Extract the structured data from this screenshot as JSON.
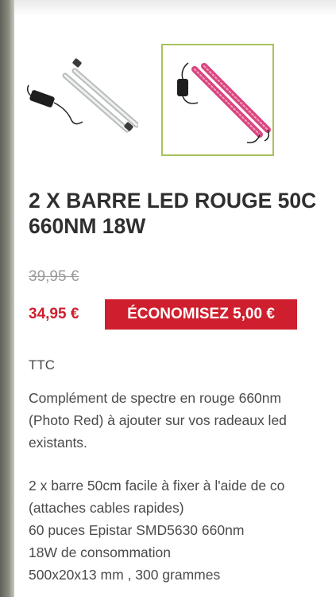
{
  "product": {
    "title_line1": "2 X BARRE LED ROUGE 50C",
    "title_line2": "660NM 18W",
    "old_price": "39,95 €",
    "price": "34,95 €",
    "discount_label": "ÉCONOMISEZ 5,00 €",
    "tax_label": "TTC",
    "description_paragraph1": [
      "Complément de spectre en rouge 660nm",
      "(Photo Red) à ajouter sur vos radeaux led",
      "existants."
    ],
    "description_paragraph2": [
      "2 x barre 50cm facile à fixer à l'aide de co",
      "(attaches cables rapides)",
      "60 puces Epistar SMD5630 660nm",
      "18W de consommation",
      "500x20x13 mm , 300 grammes"
    ]
  },
  "gallery": {
    "thumbnails": [
      {
        "icon": "white-led-bar-image",
        "selected": false
      },
      {
        "icon": "red-led-bar-image",
        "selected": true
      }
    ]
  },
  "colors": {
    "accent_red": "#cf1f2e",
    "selected_border": "#a8c25a",
    "text_dark": "#2f2f2f",
    "text_muted": "#9a9a9a"
  }
}
